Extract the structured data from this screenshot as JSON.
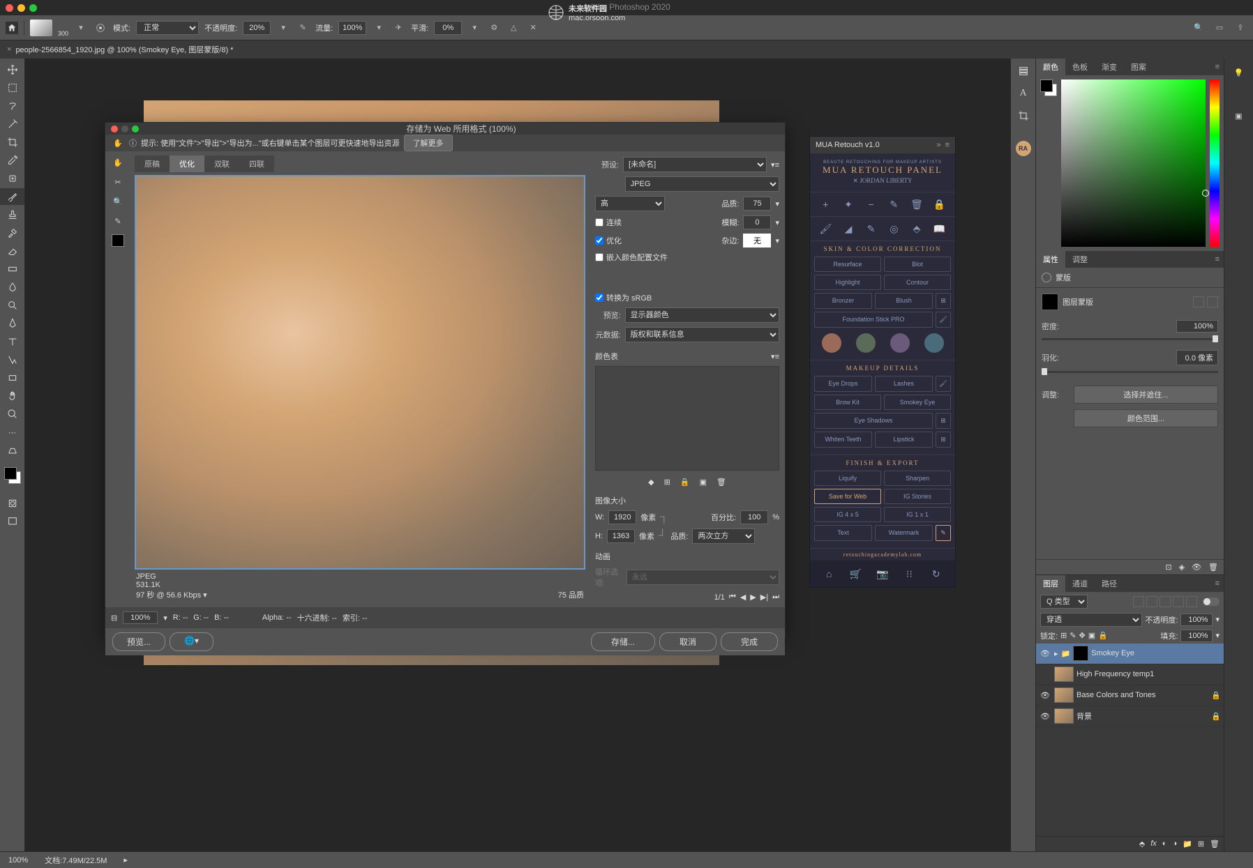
{
  "app": {
    "title": "Adobe Photoshop 2020"
  },
  "watermark": {
    "line1": "未来软件园",
    "line2": "mac.orsoon.com"
  },
  "optionsBar": {
    "brushSize": "300",
    "mode_lbl": "模式:",
    "mode": "正常",
    "opacity_lbl": "不透明度:",
    "opacity": "20%",
    "flow_lbl": "流量:",
    "flow": "100%",
    "smooth_lbl": "平滑:",
    "smooth": "0%"
  },
  "tab": {
    "name": "people-2566854_1920.jpg @ 100% (Smokey Eye, 图层蒙版/8) *"
  },
  "dialog": {
    "title": "存储为 Web 所用格式 (100%)",
    "hint": "提示: 使用\"文件\">\"导出\">\"导出为...\"或右键单击某个图层可更快速地导出资源",
    "learnMore": "了解更多",
    "tabs": [
      "原稿",
      "优化",
      "双联",
      "四联"
    ],
    "activeTab": 1,
    "preview": {
      "fmt": "JPEG",
      "size": "531.1K",
      "time": "97 秒 @ 56.6 Kbps",
      "quality": "75 品质"
    },
    "preset": {
      "lbl": "预设:",
      "val": "[未命名]"
    },
    "format": "JPEG",
    "qmode": "高",
    "quality": {
      "lbl": "品质:",
      "val": "75"
    },
    "prog": "连续",
    "blur": {
      "lbl": "模糊:",
      "val": "0"
    },
    "optim": "优化",
    "matte": {
      "lbl": "杂边:",
      "val": "无"
    },
    "embed": "嵌入颜色配置文件",
    "srgb": "转换为 sRGB",
    "prev_lbl": "预览:",
    "prev_val": "显示器颜色",
    "meta_lbl": "元数据:",
    "meta_val": "版权和联系信息",
    "colortable": "颜色表",
    "imgsize": "图像大小",
    "w_lbl": "W:",
    "w": "1920",
    "h_lbl": "H:",
    "h": "1363",
    "px": "像素",
    "pct_lbl": "百分比:",
    "pct": "100",
    "pct_u": "%",
    "q_lbl": "品质:",
    "q_val": "两次立方",
    "anim": "动画",
    "loop_lbl": "循环选项:",
    "loop": "永远",
    "frame": "1/1",
    "zoom": "100%",
    "r": "R: --",
    "g": "G: --",
    "b": "B: --",
    "alpha": "Alpha: --",
    "hex": "十六进制: --",
    "idx": "索引: --",
    "preview_btn": "预览...",
    "save": "存储...",
    "cancel": "取消",
    "done": "完成"
  },
  "mua": {
    "title": "MUA Retouch v1.0",
    "subtitle": "BEAUTE RETOUCHING FOR MAKEUP ARTISTS",
    "h1": "MUA RETOUCH PANEL",
    "h2": "✕ JORDAN LIBERTY",
    "sec1": "SKIN & COLOR CORRECTION",
    "b1": [
      "Resurface",
      "Blot"
    ],
    "b2": [
      "Highlight",
      "Contour"
    ],
    "b3": [
      "Bronzer",
      "Blush"
    ],
    "b4": "Foundation Stick PRO",
    "sec2": "MAKEUP DETAILS",
    "b5": [
      "Eye Drops",
      "Lashes"
    ],
    "b6": [
      "Brow Kit",
      "Smokey Eye"
    ],
    "b7": "Eye Shadows",
    "b8": [
      "Whiten Teeth",
      "Lipstick"
    ],
    "sec3": "FINISH & EXPORT",
    "b9": [
      "Liquify",
      "Sharpen"
    ],
    "b10": [
      "Save for Web",
      "IG Stories"
    ],
    "b11": [
      "IG 4 x 5",
      "IG 1 x 1"
    ],
    "b12": [
      "Text",
      "Watermark"
    ],
    "foot": "retouchingacademylab.com"
  },
  "colorPanel": {
    "tabs": [
      "颜色",
      "色板",
      "渐变",
      "图案"
    ]
  },
  "propsPanel": {
    "tabs": [
      "属性",
      "调整"
    ],
    "kind": "蒙版",
    "layerMask": "图层蒙版",
    "density_lbl": "密度:",
    "density": "100%",
    "feather_lbl": "羽化:",
    "feather": "0.0 像素",
    "refine_lbl": "调整:",
    "refine_btn": "选择并遮住...",
    "range_btn": "颜色范围..."
  },
  "layersPanel": {
    "tabs": [
      "图层",
      "通道",
      "路径"
    ],
    "kindf": "Q 类型",
    "blend": "穿透",
    "op_lbl": "不透明度:",
    "op": "100%",
    "lock_lbl": "锁定:",
    "fill_lbl": "填充:",
    "fill": "100%",
    "layers": [
      {
        "name": "Smokey Eye",
        "vis": true,
        "sel": true,
        "grp": true
      },
      {
        "name": "High Frequency temp1",
        "vis": false,
        "sel": false
      },
      {
        "name": "Base Colors and Tones",
        "vis": true,
        "sel": false
      },
      {
        "name": "背景",
        "vis": true,
        "sel": false
      }
    ]
  },
  "status": {
    "zoom": "100%",
    "doc": "文档:7.49M/22.5M"
  }
}
